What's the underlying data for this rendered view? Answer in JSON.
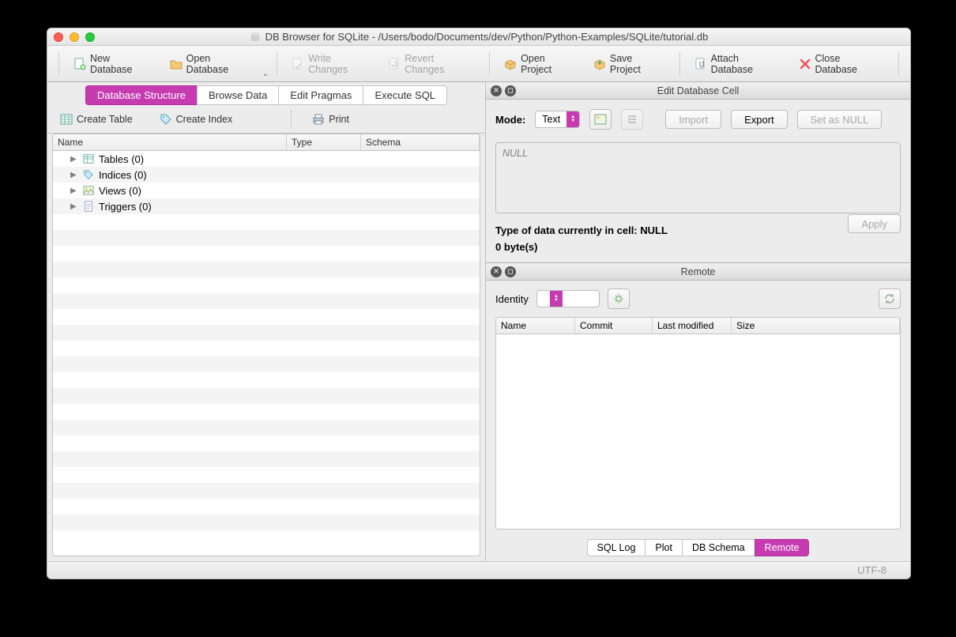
{
  "window": {
    "title": "DB Browser for SQLite - /Users/bodo/Documents/dev/Python/Python-Examples/SQLite/tutorial.db"
  },
  "toolbar": {
    "new_db": "New Database",
    "open_db": "Open Database",
    "write_changes": "Write Changes",
    "revert_changes": "Revert Changes",
    "open_project": "Open Project",
    "save_project": "Save Project",
    "attach_db": "Attach Database",
    "close_db": "Close Database"
  },
  "tabs": {
    "items": [
      "Database Structure",
      "Browse Data",
      "Edit Pragmas",
      "Execute SQL"
    ],
    "active": 0
  },
  "subtoolbar": {
    "create_table": "Create Table",
    "create_index": "Create Index",
    "print": "Print"
  },
  "tree": {
    "headers": {
      "name": "Name",
      "type": "Type",
      "schema": "Schema"
    },
    "items": [
      {
        "label": "Tables (0)",
        "icon": "table-icon"
      },
      {
        "label": "Indices (0)",
        "icon": "tag-icon"
      },
      {
        "label": "Views (0)",
        "icon": "image-icon"
      },
      {
        "label": "Triggers (0)",
        "icon": "doc-icon"
      }
    ]
  },
  "edit_cell": {
    "title": "Edit Database Cell",
    "mode_label": "Mode:",
    "mode_value": "Text",
    "import_label": "Import",
    "export_label": "Export",
    "set_null_label": "Set as NULL",
    "null_placeholder": "NULL",
    "type_status": "Type of data currently in cell: NULL",
    "bytes": "0 byte(s)",
    "apply_label": "Apply"
  },
  "remote": {
    "title": "Remote",
    "identity_label": "Identity",
    "identity_value": "",
    "headers": {
      "name": "Name",
      "commit": "Commit",
      "modified": "Last modified",
      "size": "Size"
    }
  },
  "bottom_tabs": {
    "items": [
      "SQL Log",
      "Plot",
      "DB Schema",
      "Remote"
    ],
    "active": 3
  },
  "status": {
    "encoding": "UTF-8"
  }
}
